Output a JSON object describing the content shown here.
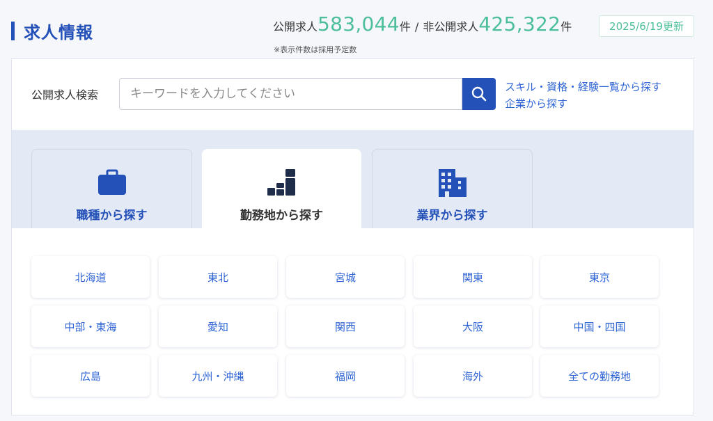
{
  "header": {
    "title": "求人情報",
    "public_label": "公開求人",
    "public_count": "583,044",
    "unit": "件",
    "separator": "/",
    "private_label": "非公開求人",
    "private_count": "425,322",
    "updated": "2025/6/19更新",
    "note": "※表示件数は採用予定数"
  },
  "search": {
    "label": "公開求人検索",
    "placeholder": "キーワードを入力してください",
    "button_icon": "search-icon",
    "links": [
      "スキル・資格・経験一覧から探す",
      "企業から探す"
    ]
  },
  "tabs": [
    {
      "label": "職種から探す",
      "icon": "briefcase-icon",
      "active": false
    },
    {
      "label": "勤務地から探す",
      "icon": "location-blocks-icon",
      "active": true
    },
    {
      "label": "業界から探す",
      "icon": "building-icon",
      "active": false
    }
  ],
  "regions": [
    "北海道",
    "東北",
    "宮城",
    "関東",
    "東京",
    "中部・東海",
    "愛知",
    "関西",
    "大阪",
    "中国・四国",
    "広島",
    "九州・沖縄",
    "福岡",
    "海外",
    "全ての勤務地"
  ],
  "colors": {
    "brand": "#2451b8",
    "accent_green": "#4cbf9a",
    "link": "#2e64d4",
    "tab_bg": "#e4e9f6"
  }
}
